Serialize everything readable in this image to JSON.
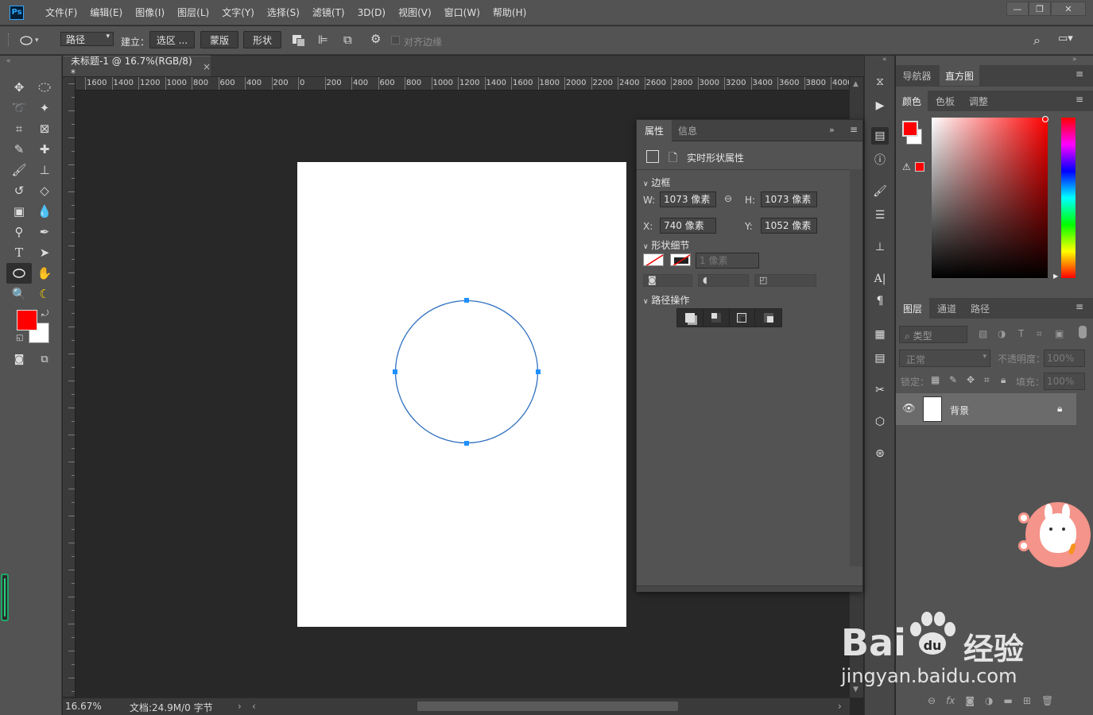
{
  "menubar": {
    "logo": "Ps",
    "items": [
      "文件(F)",
      "编辑(E)",
      "图像(I)",
      "图层(L)",
      "文字(Y)",
      "选择(S)",
      "滤镜(T)",
      "3D(D)",
      "视图(V)",
      "窗口(W)",
      "帮助(H)"
    ]
  },
  "options": {
    "mode_value": "路径",
    "build_label": "建立：",
    "selection_btn": "选区 ...",
    "mask_btn": "蒙版",
    "shape_btn": "形状",
    "align_edges": "对齐边缘"
  },
  "document": {
    "tab_title": "未标题-1 @ 16.7%(RGB/8) *",
    "close": "×"
  },
  "ruler": {
    "top_labels": [
      "1600",
      "1400",
      "1200",
      "1000",
      "800",
      "600",
      "400",
      "200",
      "0",
      "200",
      "400",
      "600",
      "800",
      "1000",
      "1200",
      "1400",
      "1600",
      "1800",
      "2000",
      "2200",
      "2400",
      "2600",
      "2800",
      "3000",
      "3200",
      "3400",
      "3600",
      "3800",
      "4000"
    ]
  },
  "statusbar": {
    "zoom": "16.67%",
    "doc_info": "文档:24.9M/0 字节"
  },
  "properties": {
    "tab_active": "属性",
    "tab_inactive": "信息",
    "header": "实时形状属性",
    "bounds_title": "边框",
    "w_label": "W:",
    "w_value": "1073 像素",
    "h_label": "H:",
    "h_value": "1073 像素",
    "x_label": "X:",
    "x_value": "740 像素",
    "y_label": "Y:",
    "y_value": "1052 像素",
    "shape_details_title": "形状细节",
    "stroke_width": "1 像素",
    "path_ops_title": "路径操作"
  },
  "right_panel": {
    "top_tabs": [
      "导航器",
      "直方图"
    ],
    "color_tabs": [
      "颜色",
      "色板",
      "调整"
    ],
    "layer_tabs": [
      "图层",
      "通道",
      "路径"
    ],
    "filter_placeholder": "类型",
    "blend_mode": "正常",
    "opacity_label": "不透明度：",
    "opacity_value": "100%",
    "lock_label": "锁定：",
    "fill_label": "填充：",
    "fill_value": "100%",
    "layer_name": "背景"
  },
  "colors": {
    "foreground": "#ff0000",
    "background": "#ffffff",
    "path_stroke": "#2f6fbf",
    "anchor": "#1e90ff"
  },
  "watermark": {
    "brand": "Bai",
    "brand2": "经验",
    "url": "jingyan.baidu.com"
  }
}
